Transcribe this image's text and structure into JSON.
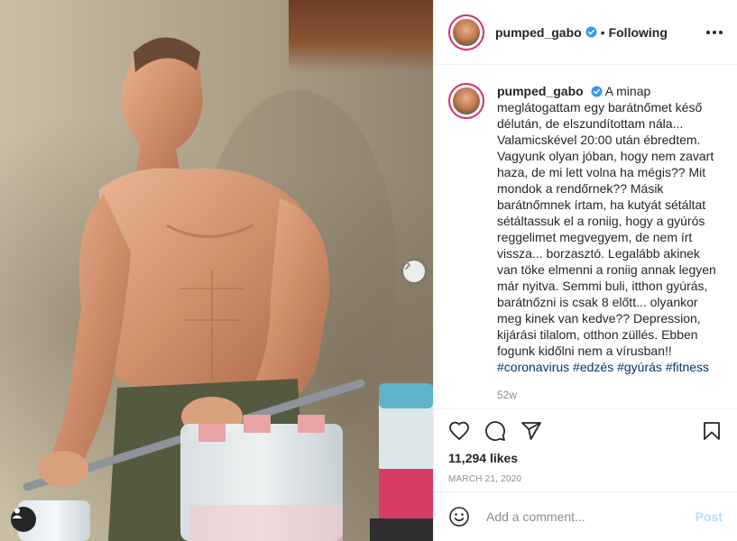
{
  "header": {
    "username": "pumped_gabo",
    "separator": "•",
    "follow_status": "Following"
  },
  "caption": {
    "username": "pumped_gabo",
    "text": "A minap meglátogattam egy barátnőmet késő délután, de elszundítottam nála... Valamicskével 20:00 után ébredtem. Vagyunk olyan jóban, hogy nem zavart haza, de mi lett volna ha mégis?? Mit mondok a rendőrnek?? Másik barátnőmnek írtam, ha kutyát sétáltat sétáltassuk el a roniig, hogy a gyúrós reggelimet megvegyem, de nem írt vissza... borzasztó. Legalább akinek van töke elmenni a roniig annak legyen már nyitva. Semmi buli, itthon gyúrás, barátnőzni is csak 8 előtt... olyankor meg kinek van kedve?? Depression, kijárási tilalom, otthon züllés. Ebben fogunk kidőlni nem a vírusban!!",
    "hashtags": [
      "#coronavirus",
      "#edzés",
      "#gyúrás",
      "#fitness"
    ],
    "time_ago": "52w"
  },
  "actions": {
    "likes": "11,294 likes",
    "date": "MARCH 21, 2020"
  },
  "comment": {
    "placeholder": "Add a comment...",
    "post_label": "Post"
  },
  "colors": {
    "verified": "#3897f0",
    "link": "#00376b",
    "post_disabled": "#b2dffc",
    "story_ring": "#de2a6d"
  },
  "icons": [
    "verified-badge-icon",
    "more-icon",
    "heart-icon",
    "comment-icon",
    "share-icon",
    "bookmark-icon",
    "emoji-icon",
    "chevron-right-icon",
    "user-tag-icon"
  ]
}
